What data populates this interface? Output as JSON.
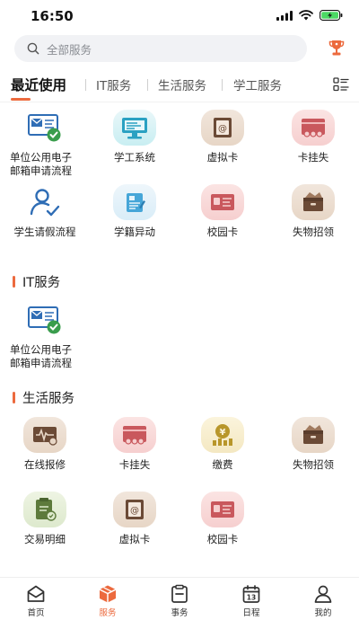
{
  "status": {
    "time": "16:50"
  },
  "search": {
    "placeholder": "全部服务"
  },
  "tabs": [
    {
      "label": "最近使用"
    },
    {
      "label": "IT服务"
    },
    {
      "label": "生活服务"
    },
    {
      "label": "学工服务"
    }
  ],
  "recent": {
    "items": [
      {
        "label": "单位公用电子邮箱申请流程",
        "icon": "email-check-icon"
      },
      {
        "label": "学工系统",
        "icon": "monitor-icon"
      },
      {
        "label": "虚拟卡",
        "icon": "virtual-card-icon"
      },
      {
        "label": "卡挂失",
        "icon": "card-loss-icon"
      },
      {
        "label": "学生请假流程",
        "icon": "person-check-icon"
      },
      {
        "label": "学籍异动",
        "icon": "student-record-icon"
      },
      {
        "label": "校园卡",
        "icon": "campus-card-icon"
      },
      {
        "label": "失物招领",
        "icon": "lost-found-box-icon"
      }
    ]
  },
  "it_section": {
    "title": "IT服务",
    "items": [
      {
        "label": "单位公用电子邮箱申请流程",
        "icon": "email-check-icon"
      }
    ]
  },
  "life_section": {
    "title": "生活服务",
    "items": [
      {
        "label": "在线报修",
        "icon": "repair-terminal-icon"
      },
      {
        "label": "卡挂失",
        "icon": "card-loss-icon"
      },
      {
        "label": "缴费",
        "icon": "payment-coin-icon"
      },
      {
        "label": "失物招领",
        "icon": "lost-found-box-icon"
      },
      {
        "label": "交易明细",
        "icon": "transaction-detail-icon"
      },
      {
        "label": "虚拟卡",
        "icon": "virtual-card-icon"
      },
      {
        "label": "校园卡",
        "icon": "campus-card-icon"
      }
    ]
  },
  "nav": [
    {
      "label": "首页",
      "icon": "home-icon"
    },
    {
      "label": "服务",
      "icon": "service-box-icon"
    },
    {
      "label": "事务",
      "icon": "clipboard-icon"
    },
    {
      "label": "日程",
      "icon": "calendar-icon"
    },
    {
      "label": "我的",
      "icon": "user-icon"
    }
  ],
  "calendar_day": "13",
  "colors": {
    "accent": "#ec6a3e",
    "text": "#222222",
    "muted": "#8a8d93"
  }
}
